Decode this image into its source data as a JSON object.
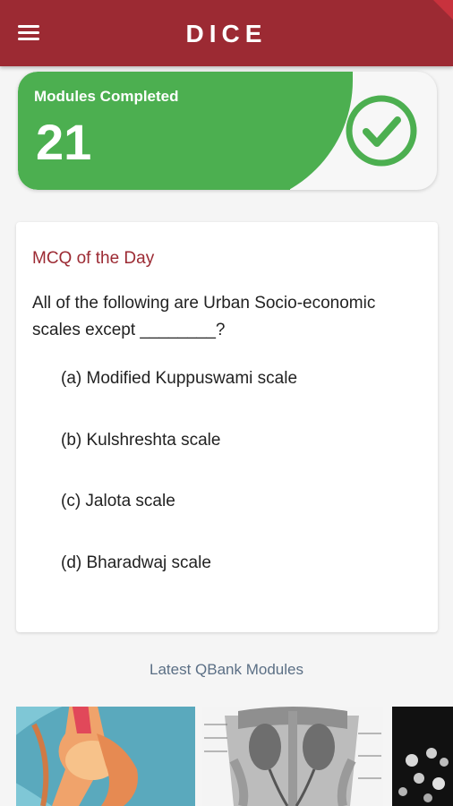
{
  "appbar": {
    "title": "DICE",
    "menu_icon": "hamburger-menu-icon"
  },
  "progress": {
    "label": "Modules Completed",
    "value": "21",
    "icon": "check-circle-icon",
    "colors": {
      "accent": "#4caf50"
    }
  },
  "mcq": {
    "heading": "MCQ of the Day",
    "question": "All of the following are Urban Socio-economic scales except ________?",
    "options": [
      {
        "label": "(a) Modified Kuppuswami scale"
      },
      {
        "label": "(b) Kulshreshta scale"
      },
      {
        "label": "(c) Jalota scale"
      },
      {
        "label": "(d) Bharadwaj scale"
      }
    ]
  },
  "qbank": {
    "title": "Latest QBank Modules",
    "modules": [
      {
        "icon": "knee-anatomy-image"
      },
      {
        "icon": "kidney-anatomy-image"
      },
      {
        "icon": "xray-image"
      }
    ]
  },
  "colors": {
    "primary": "#9c2a33",
    "section_title": "#5b6f85"
  }
}
